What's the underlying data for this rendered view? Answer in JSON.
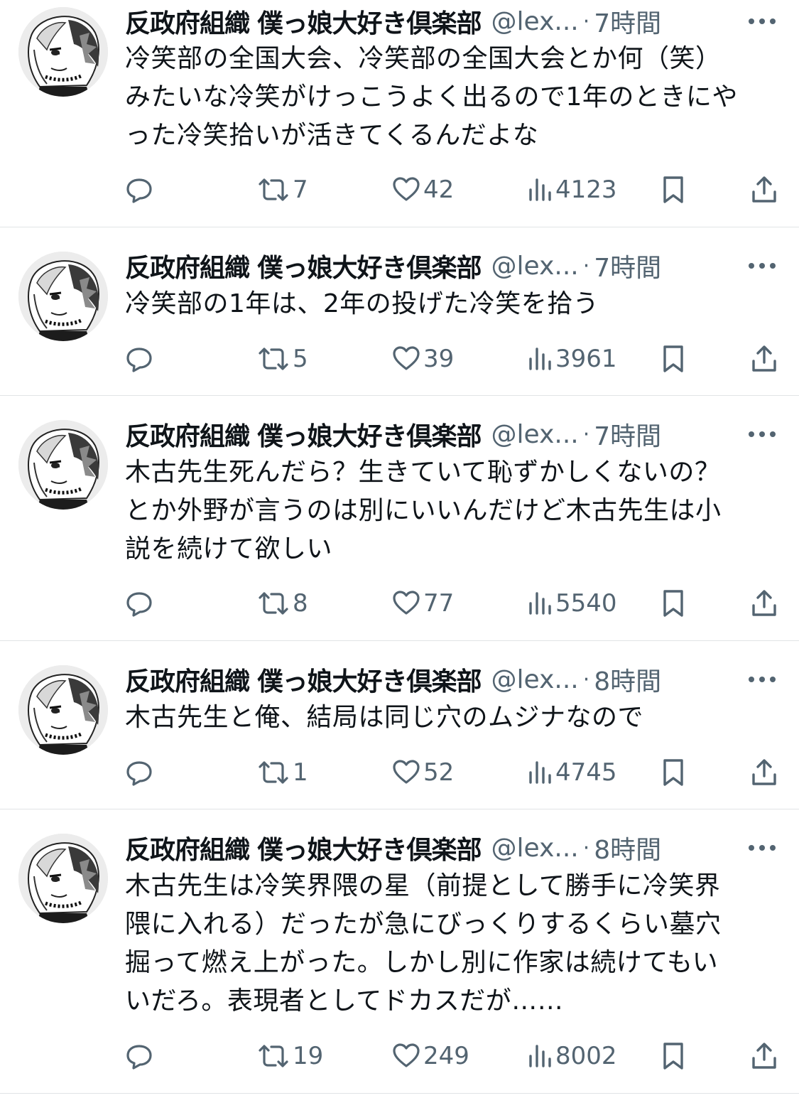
{
  "tweets": [
    {
      "author_name": "反政府組織 僕っ娘大好き倶楽部",
      "handle": "@lex...",
      "separator": "·",
      "time": "7時間",
      "text": "冷笑部の全国大会、冷笑部の全国大会とか何（笑）\nみたいな冷笑がけっこうよく出るので1年のときにや\nった冷笑拾いが活きてくるんだよな",
      "retweets": "7",
      "likes": "42",
      "views": "4123"
    },
    {
      "author_name": "反政府組織 僕っ娘大好き倶楽部",
      "handle": "@lex...",
      "separator": "·",
      "time": "7時間",
      "text": "冷笑部の1年は、2年の投げた冷笑を拾う",
      "retweets": "5",
      "likes": "39",
      "views": "3961"
    },
    {
      "author_name": "反政府組織 僕っ娘大好き倶楽部",
      "handle": "@lex...",
      "separator": "·",
      "time": "7時間",
      "text": "木古先生死んだら？生きていて恥ずかしくないの？\nとか外野が言うのは別にいいんだけど木古先生は小\n説を続けて欲しい",
      "retweets": "8",
      "likes": "77",
      "views": "5540"
    },
    {
      "author_name": "反政府組織 僕っ娘大好き倶楽部",
      "handle": "@lex...",
      "separator": "·",
      "time": "8時間",
      "text": "木古先生と俺、結局は同じ穴のムジナなので",
      "retweets": "1",
      "likes": "52",
      "views": "4745"
    },
    {
      "author_name": "反政府組織 僕っ娘大好き倶楽部",
      "handle": "@lex...",
      "separator": "·",
      "time": "8時間",
      "text": "木古先生は冷笑界隈の星（前提として勝手に冷笑界\n隈に入れる）だったが急にびっくりするくらい墓穴\n掘って燃え上がった。しかし別に作家は続けてもい\nいだろ。表現者としてドカスだが……",
      "retweets": "19",
      "likes": "249",
      "views": "8002"
    }
  ],
  "icons": {
    "reply": "speech-bubble-icon",
    "retweet": "retweet-arrows-icon",
    "like": "heart-outline-icon",
    "views": "bar-chart-icon",
    "bookmark": "bookmark-outline-icon",
    "share": "share-upload-icon",
    "more": "more-dots-icon",
    "avatar": "monochrome-anime-avatar"
  },
  "colors": {
    "text_primary": "#0f1419",
    "text_secondary": "#536471",
    "divider": "#e1e4e6",
    "background": "#ffffff"
  }
}
